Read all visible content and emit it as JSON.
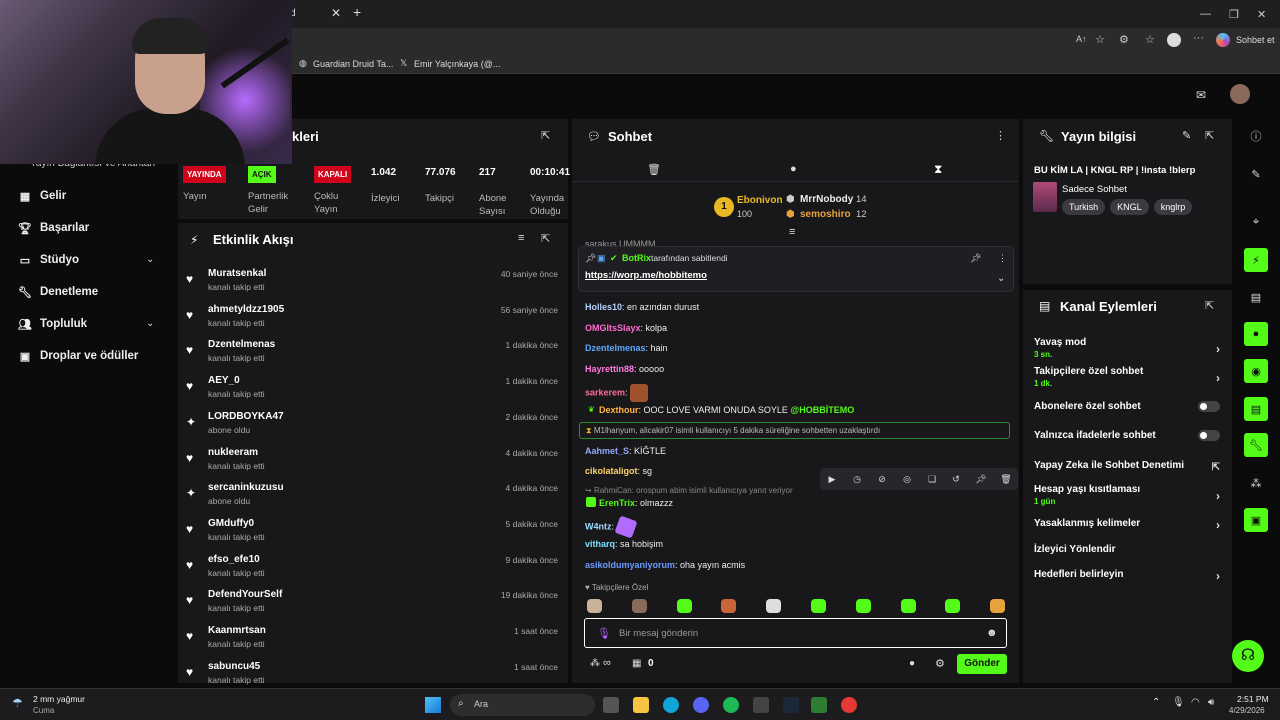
{
  "browser": {
    "tab_partial": "d",
    "bookmarks": [
      "Guardian Druid Ta...",
      "Emir Yalçınkaya (@..."
    ],
    "copilot_label": "Sohbet et"
  },
  "sidebar": {
    "header_partial": "Yayın Bağlantısı ve Anahtarı",
    "items": [
      {
        "label": "Gelir",
        "icon": "revenue-icon"
      },
      {
        "label": "Başarılar",
        "icon": "trophy-icon"
      },
      {
        "label": "Stüdyo",
        "icon": "studio-icon"
      },
      {
        "label": "Denetleme",
        "icon": "wrench-icon"
      },
      {
        "label": "Topluluk",
        "icon": "community-icon"
      },
      {
        "label": "Droplar ve ödüller",
        "icon": "drops-icon"
      }
    ]
  },
  "stats_panel": {
    "title_partial": "kleri",
    "badges": [
      {
        "badge": "YAYINDA",
        "label": "Yayın",
        "color": "#d0021b"
      },
      {
        "badge": "AÇIK",
        "label": "Partnerlik Gelir",
        "color": "#53fc18"
      },
      {
        "badge": "KAPALI",
        "label": "Çoklu Yayın",
        "color": "#d0021b"
      }
    ],
    "stats": [
      {
        "value": "1.042",
        "label": "İzleyici"
      },
      {
        "value": "77.076",
        "label": "Takipçi"
      },
      {
        "value": "217",
        "label": "Abone Sayısı"
      },
      {
        "value": "00:10:41",
        "label": "Yayında Olduğu Süre"
      }
    ]
  },
  "activity": {
    "title": "Etkinlik Akışı",
    "items": [
      {
        "name": "Muratsenkal",
        "sub": "kanalı takip etti",
        "time": "40 saniye önce",
        "icon": "heart"
      },
      {
        "name": "ahmetyldzz1905",
        "sub": "kanalı takip etti",
        "time": "56 saniye önce",
        "icon": "heart"
      },
      {
        "name": "Dzentelmenas",
        "sub": "kanalı takip etti",
        "time": "1 dakika önce",
        "icon": "heart"
      },
      {
        "name": "AEY_0",
        "sub": "kanalı takip etti",
        "time": "1 dakika önce",
        "icon": "heart"
      },
      {
        "name": "LORDBOYKA47",
        "sub": "abone oldu",
        "time": "2 dakika önce",
        "icon": "star"
      },
      {
        "name": "nukleeram",
        "sub": "kanalı takip etti",
        "time": "4 dakika önce",
        "icon": "heart"
      },
      {
        "name": "sercaninkuzusu",
        "sub": "abone oldu",
        "time": "4 dakika önce",
        "icon": "star"
      },
      {
        "name": "GMduffy0",
        "sub": "kanalı takip etti",
        "time": "5 dakika önce",
        "icon": "heart"
      },
      {
        "name": "efso_efe10",
        "sub": "kanalı takip etti",
        "time": "9 dakika önce",
        "icon": "heart"
      },
      {
        "name": "DefendYourSelf",
        "sub": "kanalı takip etti",
        "time": "19 dakika önce",
        "icon": "heart"
      },
      {
        "name": "Kaanmrtsan",
        "sub": "kanalı takip etti",
        "time": "1 saat önce",
        "icon": "heart"
      },
      {
        "name": "sabuncu45",
        "sub": "kanalı takip etti",
        "time": "1 saat önce",
        "icon": "heart"
      }
    ]
  },
  "chat": {
    "title": "Sohbet",
    "leaderboard": [
      {
        "name": "Ebonivon",
        "value": "100",
        "rank": "1"
      },
      {
        "name": "MrrNobody",
        "value": "14"
      },
      {
        "name": "semoshiro",
        "value": "12"
      }
    ],
    "hidden_line": "sarakus UMMMM",
    "pinned_by": "BotRix",
    "pinned_label": "tarafından sabitlendi",
    "pinned_link": "https://worp.me/hobbitemo",
    "messages": [
      {
        "user": "Holles10",
        "text": "en azından durust",
        "color": "#b3d4ff"
      },
      {
        "user": "OMGItsSlayx",
        "text": "kolpa",
        "color": "#ff6bcf"
      },
      {
        "user": "Dzentelmenas",
        "text": "hain",
        "color": "#5aa9ff"
      },
      {
        "user": "Hayrettin88",
        "text": "ooooo",
        "color": "#ff7adf"
      },
      {
        "user": "sarkerem",
        "text": "",
        "color": "#ff6b9a"
      },
      {
        "user": "Dexthour",
        "text": "OOC LOVE VARMI ONUDA SOYLE",
        "mention": "@HOBBİTEMO",
        "color": "#ffb347"
      },
      {
        "user": "Aahmet_S",
        "text": "KİĞTLE",
        "color": "#8fa8ff"
      },
      {
        "user": "cikolataligot",
        "text": "sg",
        "color": "#ffd36b"
      },
      {
        "user": "ErenTrix",
        "text": "olmazzz",
        "color": "#53fc18"
      },
      {
        "user": "W4ntz",
        "text": "",
        "color": "#9fdcff"
      },
      {
        "user": "vitharq",
        "text": "sa hobişim",
        "color": "#7ae0ff"
      },
      {
        "user": "asikoldumyaniyorum",
        "text": "oha yayın acmis",
        "color": "#6b9bff"
      }
    ],
    "timeout_notice": "M1lhanyum, alicakir07 isimli kullanıcıyı 5 dakika süreliğine sohbetten uzaklaştırdı",
    "reply_line": "RahmiCan: orospum abim isimli kullanıcıya yanıt veriyor",
    "followers_only": "Takipçilere Özel",
    "input_placeholder": "Bir mesaj gönderin",
    "infinite": "∞",
    "count": "0",
    "send_label": "Gönder"
  },
  "stream_info": {
    "title": "Yayın bilgisi",
    "stream_title": "BU KİM LA | KNGL RP | !insta !blerp",
    "category": "Sadece Sohbet",
    "tags": [
      "Turkish",
      "KNGL",
      "knglrp"
    ]
  },
  "channel_actions": {
    "title": "Kanal Eylemleri",
    "items": [
      {
        "label": "Yavaş mod",
        "sub": "3 sn.",
        "control": "arrow"
      },
      {
        "label": "Takipçilere özel sohbet",
        "sub": "1 dk.",
        "control": "arrow"
      },
      {
        "label": "Abonelere özel sohbet",
        "sub": "",
        "control": "toggle"
      },
      {
        "label": "Yalnızca ifadelerle sohbet",
        "sub": "",
        "control": "toggle"
      },
      {
        "label": "Yapay Zeka ile Sohbet Denetimi",
        "sub": "",
        "control": "external"
      },
      {
        "label": "Hesap yaşı kısıtlaması",
        "sub": "1 gün",
        "control": "arrow"
      },
      {
        "label": "Yasaklanmış kelimeler",
        "sub": "",
        "control": "arrow"
      },
      {
        "label": "İzleyici Yönlendir",
        "sub": "",
        "control": "none"
      },
      {
        "label": "Hedefleri belirleyin",
        "sub": "",
        "control": "arrow"
      }
    ]
  },
  "taskbar": {
    "weather_temp": "2 mm yağmur",
    "weather_day": "Cuma",
    "search": "Ara",
    "time": "2:51 PM",
    "date": "4/29/2026"
  }
}
